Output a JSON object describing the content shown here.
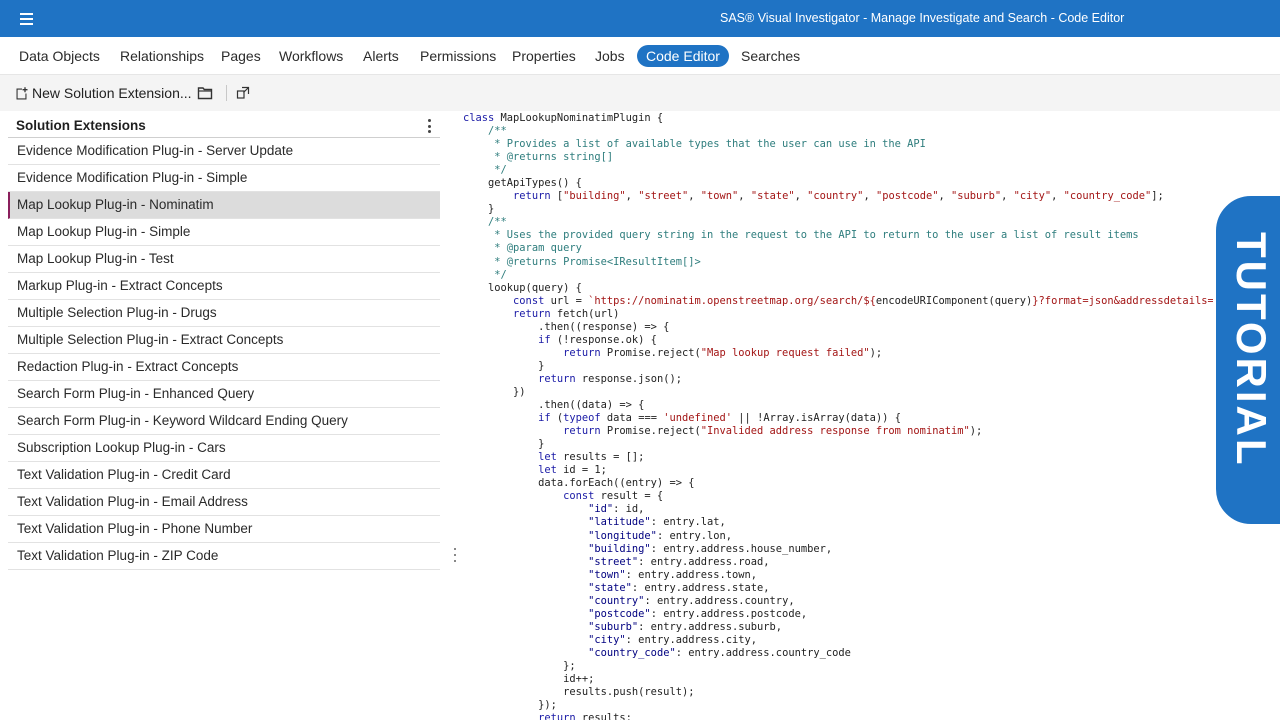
{
  "app_title": "SAS® Visual Investigator - Manage Investigate and Search - Code Editor",
  "nav_tabs": [
    {
      "label": "Data Objects"
    },
    {
      "label": "Relationships"
    },
    {
      "label": "Pages"
    },
    {
      "label": "Workflows"
    },
    {
      "label": "Alerts"
    },
    {
      "label": "Permissions"
    },
    {
      "label": "Properties"
    },
    {
      "label": "Jobs"
    },
    {
      "label": "Code Editor"
    },
    {
      "label": "Searches"
    }
  ],
  "active_tab": "Code Editor",
  "toolbar": {
    "new_extension_label": "New Solution Extension..."
  },
  "sidebar": {
    "title": "Solution Extensions",
    "selected": "Map Lookup Plug-in - Nominatim",
    "items": [
      "Evidence Modification Plug-in - Server Update",
      "Evidence Modification Plug-in - Simple",
      "Map Lookup Plug-in - Nominatim",
      "Map Lookup Plug-in - Simple",
      "Map Lookup Plug-in - Test",
      "Markup Plug-in - Extract Concepts",
      "Multiple Selection Plug-in - Drugs",
      "Multiple Selection Plug-in - Extract Concepts",
      "Redaction Plug-in - Extract Concepts",
      "Search Form Plug-in - Enhanced Query",
      "Search Form Plug-in - Keyword Wildcard Ending Query",
      "Subscription Lookup Plug-in - Cars",
      "Text Validation Plug-in - Credit Card",
      "Text Validation Plug-in - Email Address",
      "Text Validation Plug-in - Phone Number",
      "Text Validation Plug-in - ZIP Code"
    ]
  },
  "colors": {
    "brand_blue": "#1f73c4",
    "keyword": "#1a1aa6",
    "comment": "#2e7d7d",
    "string": "#a31515",
    "property": "#000080"
  },
  "code_lines": [
    [
      [
        "k",
        "class"
      ],
      [
        "t",
        " MapLookupNominatimPlugin {"
      ]
    ],
    [
      [
        "t",
        "    "
      ],
      [
        "c",
        "/**"
      ]
    ],
    [
      [
        "t",
        "     "
      ],
      [
        "c",
        "* Provides a list of available types that the user can use in the API"
      ]
    ],
    [
      [
        "t",
        "     "
      ],
      [
        "c",
        "* @returns string[]"
      ]
    ],
    [
      [
        "t",
        "     "
      ],
      [
        "c",
        "*/"
      ]
    ],
    [
      [
        "t",
        "    getApiTypes() {"
      ]
    ],
    [
      [
        "t",
        "        "
      ],
      [
        "k",
        "return"
      ],
      [
        "t",
        " ["
      ],
      [
        "s",
        "\"building\""
      ],
      [
        "t",
        ", "
      ],
      [
        "s",
        "\"street\""
      ],
      [
        "t",
        ", "
      ],
      [
        "s",
        "\"town\""
      ],
      [
        "t",
        ", "
      ],
      [
        "s",
        "\"state\""
      ],
      [
        "t",
        ", "
      ],
      [
        "s",
        "\"country\""
      ],
      [
        "t",
        ", "
      ],
      [
        "s",
        "\"postcode\""
      ],
      [
        "t",
        ", "
      ],
      [
        "s",
        "\"suburb\""
      ],
      [
        "t",
        ", "
      ],
      [
        "s",
        "\"city\""
      ],
      [
        "t",
        ", "
      ],
      [
        "s",
        "\"country_code\""
      ],
      [
        "t",
        "];"
      ]
    ],
    [
      [
        "t",
        "    }"
      ]
    ],
    [
      [
        "t",
        "    "
      ],
      [
        "c",
        "/**"
      ]
    ],
    [
      [
        "t",
        "     "
      ],
      [
        "c",
        "* Uses the provided query string in the request to the API to return to the user a list of result items"
      ]
    ],
    [
      [
        "t",
        "     "
      ],
      [
        "c",
        "* @param query"
      ]
    ],
    [
      [
        "t",
        "     "
      ],
      [
        "c",
        "* @returns Promise<IResultItem[]>"
      ]
    ],
    [
      [
        "t",
        "     "
      ],
      [
        "c",
        "*/"
      ]
    ],
    [
      [
        "t",
        "    lookup(query) {"
      ]
    ],
    [
      [
        "t",
        "        "
      ],
      [
        "k",
        "const"
      ],
      [
        "t",
        " url = "
      ],
      [
        "s",
        "`https://nominatim.openstreetmap.org/search/${"
      ],
      [
        "t",
        "encodeURIComponent(query)"
      ],
      [
        "s",
        "}?format=json&addressdetails=1`"
      ],
      [
        "t",
        ";"
      ]
    ],
    [
      [
        "t",
        "        "
      ],
      [
        "k",
        "return"
      ],
      [
        "t",
        " fetch(url)"
      ]
    ],
    [
      [
        "t",
        "            .then((response) => {"
      ]
    ],
    [
      [
        "t",
        "            "
      ],
      [
        "k",
        "if"
      ],
      [
        "t",
        " (!response.ok) {"
      ]
    ],
    [
      [
        "t",
        "                "
      ],
      [
        "k",
        "return"
      ],
      [
        "t",
        " Promise.reject("
      ],
      [
        "s",
        "\"Map lookup request failed\""
      ],
      [
        "t",
        ");"
      ]
    ],
    [
      [
        "t",
        "            }"
      ]
    ],
    [
      [
        "t",
        "            "
      ],
      [
        "k",
        "return"
      ],
      [
        "t",
        " response.json();"
      ]
    ],
    [
      [
        "t",
        "        })"
      ]
    ],
    [
      [
        "t",
        "            .then((data) => {"
      ]
    ],
    [
      [
        "t",
        "            "
      ],
      [
        "k",
        "if"
      ],
      [
        "t",
        " ("
      ],
      [
        "k",
        "typeof"
      ],
      [
        "t",
        " data === "
      ],
      [
        "s",
        "'undefined'"
      ],
      [
        "t",
        " || !Array.isArray(data)) {"
      ]
    ],
    [
      [
        "t",
        "                "
      ],
      [
        "k",
        "return"
      ],
      [
        "t",
        " Promise.reject("
      ],
      [
        "s",
        "\"Invalided address response from nominatim\""
      ],
      [
        "t",
        ");"
      ]
    ],
    [
      [
        "t",
        "            }"
      ]
    ],
    [
      [
        "t",
        "            "
      ],
      [
        "k",
        "let"
      ],
      [
        "t",
        " results = [];"
      ]
    ],
    [
      [
        "t",
        "            "
      ],
      [
        "k",
        "let"
      ],
      [
        "t",
        " id = 1;"
      ]
    ],
    [
      [
        "t",
        "            data.forEach((entry) => {"
      ]
    ],
    [
      [
        "t",
        "                "
      ],
      [
        "k",
        "const"
      ],
      [
        "t",
        " result = {"
      ]
    ],
    [
      [
        "t",
        "                    "
      ],
      [
        "p",
        "\"id\""
      ],
      [
        "t",
        ": id,"
      ]
    ],
    [
      [
        "t",
        "                    "
      ],
      [
        "p",
        "\"latitude\""
      ],
      [
        "t",
        ": entry.lat,"
      ]
    ],
    [
      [
        "t",
        "                    "
      ],
      [
        "p",
        "\"longitude\""
      ],
      [
        "t",
        ": entry.lon,"
      ]
    ],
    [
      [
        "t",
        "                    "
      ],
      [
        "p",
        "\"building\""
      ],
      [
        "t",
        ": entry.address.house_number,"
      ]
    ],
    [
      [
        "t",
        "                    "
      ],
      [
        "p",
        "\"street\""
      ],
      [
        "t",
        ": entry.address.road,"
      ]
    ],
    [
      [
        "t",
        "                    "
      ],
      [
        "p",
        "\"town\""
      ],
      [
        "t",
        ": entry.address.town,"
      ]
    ],
    [
      [
        "t",
        "                    "
      ],
      [
        "p",
        "\"state\""
      ],
      [
        "t",
        ": entry.address.state,"
      ]
    ],
    [
      [
        "t",
        "                    "
      ],
      [
        "p",
        "\"country\""
      ],
      [
        "t",
        ": entry.address.country,"
      ]
    ],
    [
      [
        "t",
        "                    "
      ],
      [
        "p",
        "\"postcode\""
      ],
      [
        "t",
        ": entry.address.postcode,"
      ]
    ],
    [
      [
        "t",
        "                    "
      ],
      [
        "p",
        "\"suburb\""
      ],
      [
        "t",
        ": entry.address.suburb,"
      ]
    ],
    [
      [
        "t",
        "                    "
      ],
      [
        "p",
        "\"city\""
      ],
      [
        "t",
        ": entry.address.city,"
      ]
    ],
    [
      [
        "t",
        "                    "
      ],
      [
        "p",
        "\"country_code\""
      ],
      [
        "t",
        ": entry.address.country_code"
      ]
    ],
    [
      [
        "t",
        "                };"
      ]
    ],
    [
      [
        "t",
        "                id++;"
      ]
    ],
    [
      [
        "t",
        "                results.push(result);"
      ]
    ],
    [
      [
        "t",
        "            });"
      ]
    ],
    [
      [
        "t",
        "            "
      ],
      [
        "k",
        "return"
      ],
      [
        "t",
        " results;"
      ]
    ]
  ],
  "overlay_badge": "TUTORIAL"
}
